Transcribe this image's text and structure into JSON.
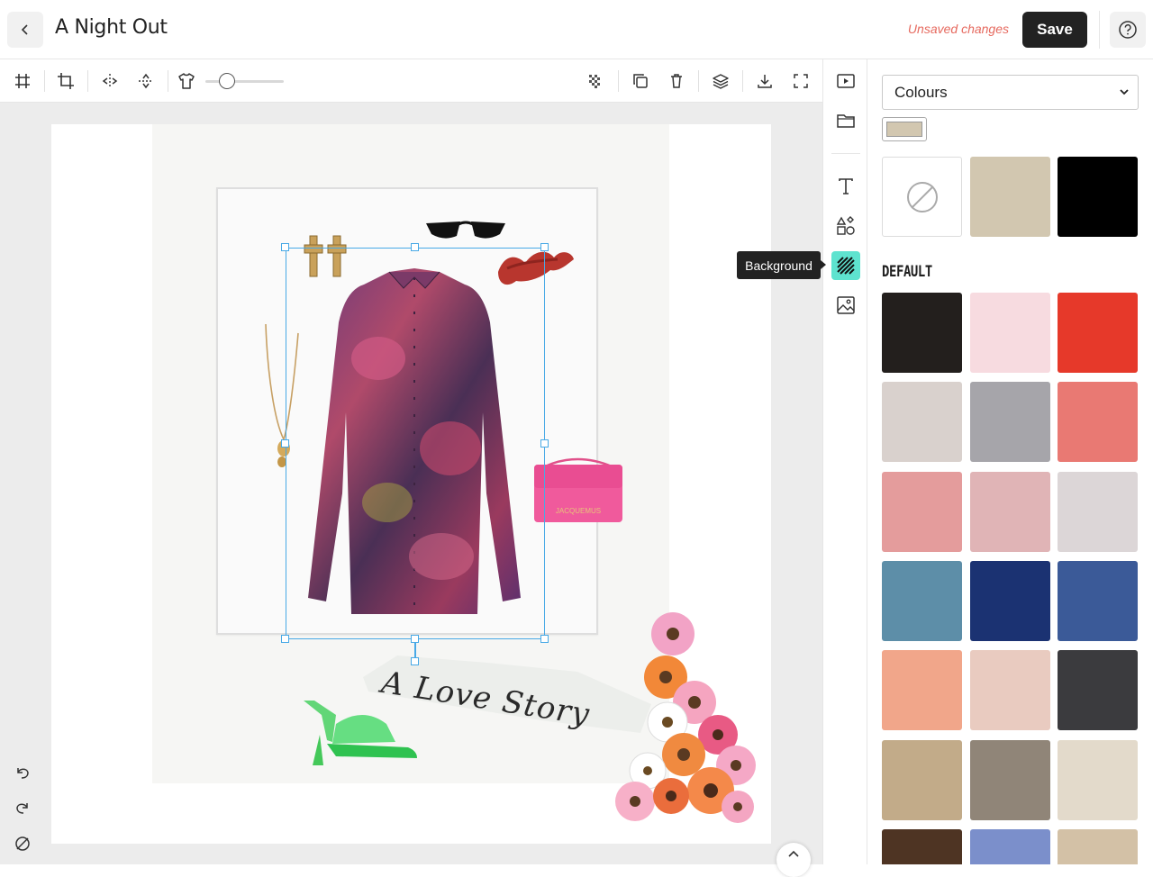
{
  "header": {
    "title": "A Night Out",
    "unsaved_text": "Unsaved changes",
    "save_label": "Save"
  },
  "toolbar": {
    "icons": [
      "grid-icon",
      "crop-icon",
      "flip-horizontal-icon",
      "flip-vertical-icon",
      "shirt-icon",
      "transparency-icon",
      "duplicate-icon",
      "trash-icon",
      "layers-icon",
      "download-icon",
      "fullscreen-icon"
    ],
    "opacity_slider_value": 0.25
  },
  "canvas": {
    "caption_text": "A Love Story",
    "bag_brand": "JACQUEMUS"
  },
  "rail": {
    "icons": [
      "present-icon",
      "folder-icon",
      "text-icon",
      "shapes-icon",
      "background-icon",
      "image-icon"
    ],
    "tooltip": "Background"
  },
  "panel": {
    "select_value": "Colours",
    "current_color": "#d2c7b0",
    "recent_colors": [
      "none",
      "#d2c7b0",
      "#000000"
    ],
    "section_label": "DEFAULT",
    "default_colors": [
      "#231f1d",
      "#f7dbe0",
      "#e6392a",
      "#d9d1cd",
      "#a6a5aa",
      "#e97973",
      "#e49c9c",
      "#e0b4b6",
      "#dcd6d7",
      "#5d8ea8",
      "#1b3272",
      "#3b5a98",
      "#f1a68a",
      "#e9cbc0",
      "#3b3b3e",
      "#c2ab89",
      "#908578",
      "#e3dacb",
      "#4e3423",
      "#7b8fcb",
      "#d3c1a6"
    ]
  },
  "history": {
    "icons": [
      "undo-icon",
      "redo-icon",
      "clear-icon"
    ]
  }
}
